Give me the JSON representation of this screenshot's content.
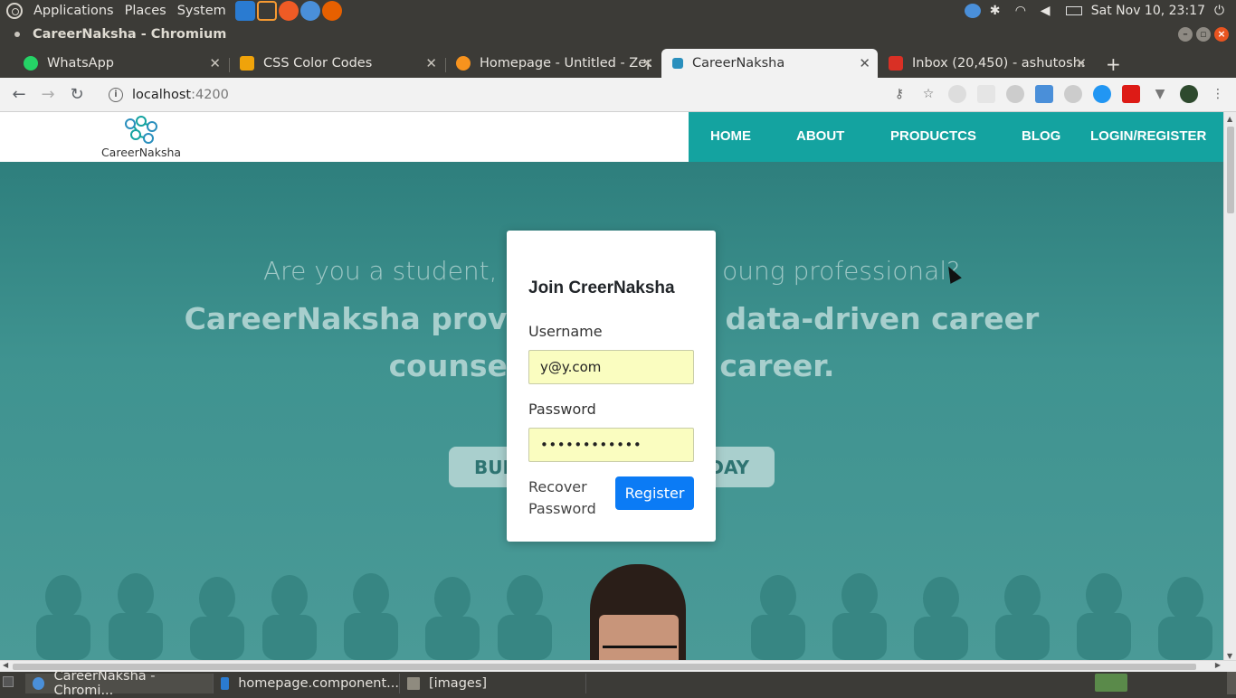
{
  "os_panel": {
    "menus": [
      "Applications",
      "Places",
      "System"
    ],
    "clock": "Sat Nov 10, 23:17"
  },
  "window": {
    "title": "CareerNaksha - Chromium"
  },
  "tabs": [
    {
      "label": "WhatsApp",
      "favicon_color": "#25d366"
    },
    {
      "label": "CSS Color Codes",
      "favicon_color": "#f0a30a"
    },
    {
      "label": "Homepage - Untitled - Zep",
      "favicon_color": "#f7931e"
    },
    {
      "label": "CareerNaksha",
      "favicon_color": "#2a8fbd"
    },
    {
      "label": "Inbox (20,450) - ashutoshs",
      "favicon_color": "#d93025"
    }
  ],
  "toolbar": {
    "url_host": "localhost",
    "url_port": ":4200"
  },
  "site": {
    "logo_text": "CareerNaksha",
    "nav": [
      "HOME",
      "ABOUT",
      "PRODUCTCS",
      "BLOG",
      "LOGIN/REGISTER"
    ],
    "brand_color": "#14a3a0",
    "hero_question": "Are you a student, a                         oung professional?",
    "hero_line1": "CareerNaksha provide           ed data-driven career",
    "hero_line2": "counselli             ur career.",
    "cta_left": "BUI",
    "cta_right": "DAY"
  },
  "modal": {
    "title": "Join CreerNaksha",
    "username_label": "Username",
    "username_value": "y@y.com",
    "password_label": "Password",
    "password_value": "••••••••••••",
    "recover_label": "Recover Password",
    "register_label": "Register",
    "button_color": "#0b7bf5",
    "field_bg": "#fafdc0"
  },
  "taskbar": {
    "items": [
      "CareerNaksha - Chromi...",
      "homepage.component...",
      "[images]"
    ]
  }
}
